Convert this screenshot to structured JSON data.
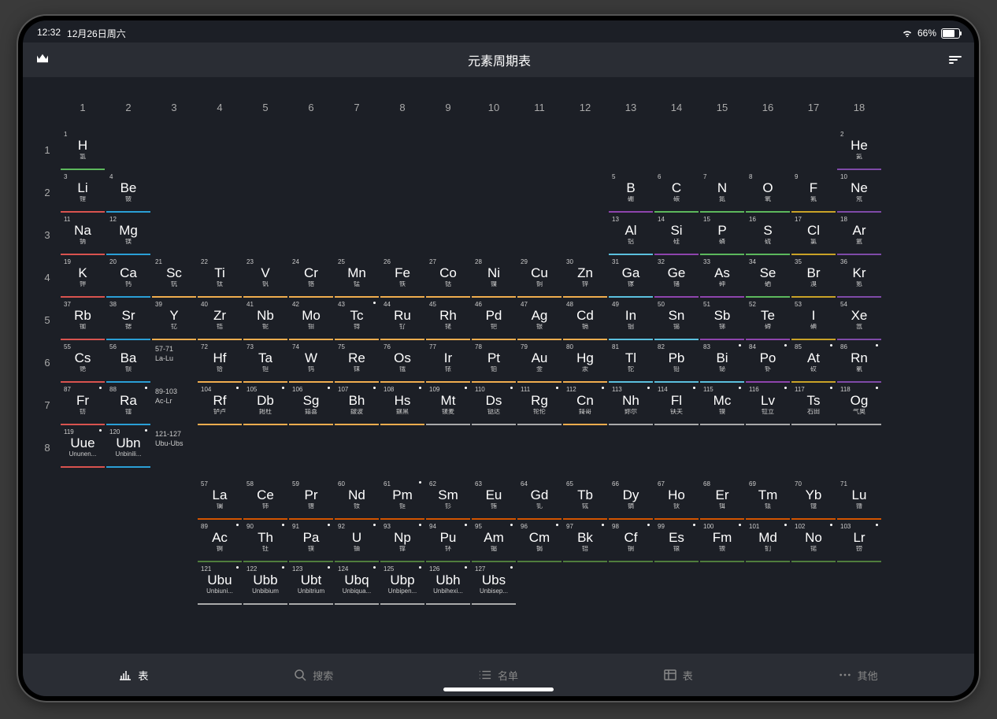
{
  "status": {
    "time": "12:32",
    "date": "12月26日周六",
    "battery": "66%"
  },
  "header": {
    "title": "元素周期表"
  },
  "tabs": [
    {
      "icon": "chart",
      "label": "表"
    },
    {
      "icon": "search",
      "label": "搜索"
    },
    {
      "icon": "list",
      "label": "名单"
    },
    {
      "icon": "grid",
      "label": "表"
    },
    {
      "icon": "more",
      "label": "其他"
    }
  ],
  "groups": [
    "1",
    "2",
    "3",
    "4",
    "5",
    "6",
    "7",
    "8",
    "9",
    "10",
    "11",
    "12",
    "13",
    "14",
    "15",
    "16",
    "17",
    "18"
  ],
  "periods": [
    "1",
    "2",
    "3",
    "4",
    "5",
    "6",
    "7",
    "8"
  ],
  "ranges": {
    "lan": {
      "top": "57-71",
      "bot": "La-Lu"
    },
    "act": {
      "top": "89-103",
      "bot": "Ac-Lr"
    },
    "ext": {
      "top": "121-127",
      "bot": "Ubu-Ubs"
    }
  },
  "elements": [
    {
      "n": 1,
      "s": "H",
      "nm": "氢",
      "r": 1,
      "c": 1,
      "cat": "nonmetal"
    },
    {
      "n": 2,
      "s": "He",
      "nm": "氦",
      "r": 1,
      "c": 18,
      "cat": "noble"
    },
    {
      "n": 3,
      "s": "Li",
      "nm": "锂",
      "r": 2,
      "c": 1,
      "cat": "alkali"
    },
    {
      "n": 4,
      "s": "Be",
      "nm": "铍",
      "r": 2,
      "c": 2,
      "cat": "alkaline"
    },
    {
      "n": 5,
      "s": "B",
      "nm": "硼",
      "r": 2,
      "c": 13,
      "cat": "metalloid"
    },
    {
      "n": 6,
      "s": "C",
      "nm": "碳",
      "r": 2,
      "c": 14,
      "cat": "nonmetal"
    },
    {
      "n": 7,
      "s": "N",
      "nm": "氮",
      "r": 2,
      "c": 15,
      "cat": "nonmetal"
    },
    {
      "n": 8,
      "s": "O",
      "nm": "氧",
      "r": 2,
      "c": 16,
      "cat": "nonmetal"
    },
    {
      "n": 9,
      "s": "F",
      "nm": "氟",
      "r": 2,
      "c": 17,
      "cat": "halogen"
    },
    {
      "n": 10,
      "s": "Ne",
      "nm": "氖",
      "r": 2,
      "c": 18,
      "cat": "noble"
    },
    {
      "n": 11,
      "s": "Na",
      "nm": "钠",
      "r": 3,
      "c": 1,
      "cat": "alkali"
    },
    {
      "n": 12,
      "s": "Mg",
      "nm": "镁",
      "r": 3,
      "c": 2,
      "cat": "alkaline"
    },
    {
      "n": 13,
      "s": "Al",
      "nm": "铝",
      "r": 3,
      "c": 13,
      "cat": "post"
    },
    {
      "n": 14,
      "s": "Si",
      "nm": "硅",
      "r": 3,
      "c": 14,
      "cat": "metalloid"
    },
    {
      "n": 15,
      "s": "P",
      "nm": "磷",
      "r": 3,
      "c": 15,
      "cat": "nonmetal"
    },
    {
      "n": 16,
      "s": "S",
      "nm": "硫",
      "r": 3,
      "c": 16,
      "cat": "nonmetal"
    },
    {
      "n": 17,
      "s": "Cl",
      "nm": "氯",
      "r": 3,
      "c": 17,
      "cat": "halogen"
    },
    {
      "n": 18,
      "s": "Ar",
      "nm": "氩",
      "r": 3,
      "c": 18,
      "cat": "noble"
    },
    {
      "n": 19,
      "s": "K",
      "nm": "钾",
      "r": 4,
      "c": 1,
      "cat": "alkali"
    },
    {
      "n": 20,
      "s": "Ca",
      "nm": "钙",
      "r": 4,
      "c": 2,
      "cat": "alkaline"
    },
    {
      "n": 21,
      "s": "Sc",
      "nm": "钪",
      "r": 4,
      "c": 3,
      "cat": "trans"
    },
    {
      "n": 22,
      "s": "Ti",
      "nm": "钛",
      "r": 4,
      "c": 4,
      "cat": "trans"
    },
    {
      "n": 23,
      "s": "V",
      "nm": "钒",
      "r": 4,
      "c": 5,
      "cat": "trans"
    },
    {
      "n": 24,
      "s": "Cr",
      "nm": "铬",
      "r": 4,
      "c": 6,
      "cat": "trans"
    },
    {
      "n": 25,
      "s": "Mn",
      "nm": "锰",
      "r": 4,
      "c": 7,
      "cat": "trans"
    },
    {
      "n": 26,
      "s": "Fe",
      "nm": "铁",
      "r": 4,
      "c": 8,
      "cat": "trans"
    },
    {
      "n": 27,
      "s": "Co",
      "nm": "钴",
      "r": 4,
      "c": 9,
      "cat": "trans"
    },
    {
      "n": 28,
      "s": "Ni",
      "nm": "镍",
      "r": 4,
      "c": 10,
      "cat": "trans"
    },
    {
      "n": 29,
      "s": "Cu",
      "nm": "铜",
      "r": 4,
      "c": 11,
      "cat": "trans"
    },
    {
      "n": 30,
      "s": "Zn",
      "nm": "锌",
      "r": 4,
      "c": 12,
      "cat": "trans"
    },
    {
      "n": 31,
      "s": "Ga",
      "nm": "镓",
      "r": 4,
      "c": 13,
      "cat": "post"
    },
    {
      "n": 32,
      "s": "Ge",
      "nm": "锗",
      "r": 4,
      "c": 14,
      "cat": "metalloid"
    },
    {
      "n": 33,
      "s": "As",
      "nm": "砷",
      "r": 4,
      "c": 15,
      "cat": "metalloid"
    },
    {
      "n": 34,
      "s": "Se",
      "nm": "硒",
      "r": 4,
      "c": 16,
      "cat": "nonmetal"
    },
    {
      "n": 35,
      "s": "Br",
      "nm": "溴",
      "r": 4,
      "c": 17,
      "cat": "halogen"
    },
    {
      "n": 36,
      "s": "Kr",
      "nm": "氪",
      "r": 4,
      "c": 18,
      "cat": "noble"
    },
    {
      "n": 37,
      "s": "Rb",
      "nm": "铷",
      "r": 5,
      "c": 1,
      "cat": "alkali"
    },
    {
      "n": 38,
      "s": "Sr",
      "nm": "锶",
      "r": 5,
      "c": 2,
      "cat": "alkaline"
    },
    {
      "n": 39,
      "s": "Y",
      "nm": "钇",
      "r": 5,
      "c": 3,
      "cat": "trans"
    },
    {
      "n": 40,
      "s": "Zr",
      "nm": "锆",
      "r": 5,
      "c": 4,
      "cat": "trans"
    },
    {
      "n": 41,
      "s": "Nb",
      "nm": "铌",
      "r": 5,
      "c": 5,
      "cat": "trans"
    },
    {
      "n": 42,
      "s": "Mo",
      "nm": "钼",
      "r": 5,
      "c": 6,
      "cat": "trans"
    },
    {
      "n": 43,
      "s": "Tc",
      "nm": "锝",
      "r": 5,
      "c": 7,
      "cat": "trans",
      "d": 1
    },
    {
      "n": 44,
      "s": "Ru",
      "nm": "钌",
      "r": 5,
      "c": 8,
      "cat": "trans"
    },
    {
      "n": 45,
      "s": "Rh",
      "nm": "铑",
      "r": 5,
      "c": 9,
      "cat": "trans"
    },
    {
      "n": 46,
      "s": "Pd",
      "nm": "钯",
      "r": 5,
      "c": 10,
      "cat": "trans"
    },
    {
      "n": 47,
      "s": "Ag",
      "nm": "银",
      "r": 5,
      "c": 11,
      "cat": "trans"
    },
    {
      "n": 48,
      "s": "Cd",
      "nm": "镉",
      "r": 5,
      "c": 12,
      "cat": "trans"
    },
    {
      "n": 49,
      "s": "In",
      "nm": "铟",
      "r": 5,
      "c": 13,
      "cat": "post"
    },
    {
      "n": 50,
      "s": "Sn",
      "nm": "锡",
      "r": 5,
      "c": 14,
      "cat": "post"
    },
    {
      "n": 51,
      "s": "Sb",
      "nm": "锑",
      "r": 5,
      "c": 15,
      "cat": "metalloid"
    },
    {
      "n": 52,
      "s": "Te",
      "nm": "碲",
      "r": 5,
      "c": 16,
      "cat": "metalloid"
    },
    {
      "n": 53,
      "s": "I",
      "nm": "碘",
      "r": 5,
      "c": 17,
      "cat": "halogen"
    },
    {
      "n": 54,
      "s": "Xe",
      "nm": "氙",
      "r": 5,
      "c": 18,
      "cat": "noble"
    },
    {
      "n": 55,
      "s": "Cs",
      "nm": "铯",
      "r": 6,
      "c": 1,
      "cat": "alkali"
    },
    {
      "n": 56,
      "s": "Ba",
      "nm": "钡",
      "r": 6,
      "c": 2,
      "cat": "alkaline"
    },
    {
      "n": 72,
      "s": "Hf",
      "nm": "铪",
      "r": 6,
      "c": 4,
      "cat": "trans"
    },
    {
      "n": 73,
      "s": "Ta",
      "nm": "钽",
      "r": 6,
      "c": 5,
      "cat": "trans"
    },
    {
      "n": 74,
      "s": "W",
      "nm": "钨",
      "r": 6,
      "c": 6,
      "cat": "trans"
    },
    {
      "n": 75,
      "s": "Re",
      "nm": "铼",
      "r": 6,
      "c": 7,
      "cat": "trans"
    },
    {
      "n": 76,
      "s": "Os",
      "nm": "锇",
      "r": 6,
      "c": 8,
      "cat": "trans"
    },
    {
      "n": 77,
      "s": "Ir",
      "nm": "铱",
      "r": 6,
      "c": 9,
      "cat": "trans"
    },
    {
      "n": 78,
      "s": "Pt",
      "nm": "铂",
      "r": 6,
      "c": 10,
      "cat": "trans"
    },
    {
      "n": 79,
      "s": "Au",
      "nm": "金",
      "r": 6,
      "c": 11,
      "cat": "trans"
    },
    {
      "n": 80,
      "s": "Hg",
      "nm": "汞",
      "r": 6,
      "c": 12,
      "cat": "trans"
    },
    {
      "n": 81,
      "s": "Tl",
      "nm": "铊",
      "r": 6,
      "c": 13,
      "cat": "post"
    },
    {
      "n": 82,
      "s": "Pb",
      "nm": "铅",
      "r": 6,
      "c": 14,
      "cat": "post"
    },
    {
      "n": 83,
      "s": "Bi",
      "nm": "铋",
      "r": 6,
      "c": 15,
      "cat": "post",
      "d": 1
    },
    {
      "n": 84,
      "s": "Po",
      "nm": "钋",
      "r": 6,
      "c": 16,
      "cat": "metalloid",
      "d": 1
    },
    {
      "n": 85,
      "s": "At",
      "nm": "砹",
      "r": 6,
      "c": 17,
      "cat": "halogen",
      "d": 1
    },
    {
      "n": 86,
      "s": "Rn",
      "nm": "氡",
      "r": 6,
      "c": 18,
      "cat": "noble",
      "d": 1
    },
    {
      "n": 87,
      "s": "Fr",
      "nm": "钫",
      "r": 7,
      "c": 1,
      "cat": "alkali",
      "d": 1
    },
    {
      "n": 88,
      "s": "Ra",
      "nm": "镭",
      "r": 7,
      "c": 2,
      "cat": "alkaline",
      "d": 1
    },
    {
      "n": 104,
      "s": "Rf",
      "nm": "𬬻卢",
      "r": 7,
      "c": 4,
      "cat": "trans",
      "d": 1
    },
    {
      "n": 105,
      "s": "Db",
      "nm": "𨧀杜",
      "r": 7,
      "c": 5,
      "cat": "trans",
      "d": 1
    },
    {
      "n": 106,
      "s": "Sg",
      "nm": "𨭎喜",
      "r": 7,
      "c": 6,
      "cat": "trans",
      "d": 1
    },
    {
      "n": 107,
      "s": "Bh",
      "nm": "𨨏波",
      "r": 7,
      "c": 7,
      "cat": "trans",
      "d": 1
    },
    {
      "n": 108,
      "s": "Hs",
      "nm": "𨭆黑",
      "r": 7,
      "c": 8,
      "cat": "trans",
      "d": 1
    },
    {
      "n": 109,
      "s": "Mt",
      "nm": "鿏麦",
      "r": 7,
      "c": 9,
      "cat": "unknown",
      "d": 1
    },
    {
      "n": 110,
      "s": "Ds",
      "nm": "𫟼达",
      "r": 7,
      "c": 10,
      "cat": "unknown",
      "d": 1
    },
    {
      "n": 111,
      "s": "Rg",
      "nm": "𬬭伦",
      "r": 7,
      "c": 11,
      "cat": "unknown",
      "d": 1
    },
    {
      "n": 112,
      "s": "Cn",
      "nm": "鎶哥",
      "r": 7,
      "c": 12,
      "cat": "trans",
      "d": 1
    },
    {
      "n": 113,
      "s": "Nh",
      "nm": "鉨尔",
      "r": 7,
      "c": 13,
      "cat": "unknown",
      "d": 1
    },
    {
      "n": 114,
      "s": "Fl",
      "nm": "𫓧夫",
      "r": 7,
      "c": 14,
      "cat": "unknown",
      "d": 1
    },
    {
      "n": 115,
      "s": "Mc",
      "nm": "镆",
      "r": 7,
      "c": 15,
      "cat": "unknown",
      "d": 1
    },
    {
      "n": 116,
      "s": "Lv",
      "nm": "𫟷立",
      "r": 7,
      "c": 16,
      "cat": "unknown",
      "d": 1
    },
    {
      "n": 117,
      "s": "Ts",
      "nm": "石田",
      "r": 7,
      "c": 17,
      "cat": "unknown",
      "d": 1
    },
    {
      "n": 118,
      "s": "Og",
      "nm": "气奥",
      "r": 7,
      "c": 18,
      "cat": "unknown",
      "d": 1
    },
    {
      "n": 119,
      "s": "Uue",
      "nm": "Ununen...",
      "r": 8,
      "c": 1,
      "cat": "alkali",
      "d": 1
    },
    {
      "n": 120,
      "s": "Ubn",
      "nm": "Unbinili...",
      "r": 8,
      "c": 2,
      "cat": "alkaline",
      "d": 1
    }
  ],
  "lanthanides": [
    {
      "n": 57,
      "s": "La",
      "nm": "镧",
      "cat": "lan"
    },
    {
      "n": 58,
      "s": "Ce",
      "nm": "铈",
      "cat": "lan"
    },
    {
      "n": 59,
      "s": "Pr",
      "nm": "镨",
      "cat": "lan"
    },
    {
      "n": 60,
      "s": "Nd",
      "nm": "钕",
      "cat": "lan"
    },
    {
      "n": 61,
      "s": "Pm",
      "nm": "钷",
      "cat": "lan",
      "d": 1
    },
    {
      "n": 62,
      "s": "Sm",
      "nm": "钐",
      "cat": "lan"
    },
    {
      "n": 63,
      "s": "Eu",
      "nm": "铕",
      "cat": "lan"
    },
    {
      "n": 64,
      "s": "Gd",
      "nm": "钆",
      "cat": "lan"
    },
    {
      "n": 65,
      "s": "Tb",
      "nm": "铽",
      "cat": "lan"
    },
    {
      "n": 66,
      "s": "Dy",
      "nm": "镝",
      "cat": "lan"
    },
    {
      "n": 67,
      "s": "Ho",
      "nm": "钬",
      "cat": "lan"
    },
    {
      "n": 68,
      "s": "Er",
      "nm": "铒",
      "cat": "lan"
    },
    {
      "n": 69,
      "s": "Tm",
      "nm": "铥",
      "cat": "lan"
    },
    {
      "n": 70,
      "s": "Yb",
      "nm": "镱",
      "cat": "lan"
    },
    {
      "n": 71,
      "s": "Lu",
      "nm": "镥",
      "cat": "lan"
    }
  ],
  "actinides": [
    {
      "n": 89,
      "s": "Ac",
      "nm": "锕",
      "cat": "act",
      "d": 1
    },
    {
      "n": 90,
      "s": "Th",
      "nm": "钍",
      "cat": "act",
      "d": 1
    },
    {
      "n": 91,
      "s": "Pa",
      "nm": "镤",
      "cat": "act",
      "d": 1
    },
    {
      "n": 92,
      "s": "U",
      "nm": "铀",
      "cat": "act",
      "d": 1
    },
    {
      "n": 93,
      "s": "Np",
      "nm": "镎",
      "cat": "act",
      "d": 1
    },
    {
      "n": 94,
      "s": "Pu",
      "nm": "钚",
      "cat": "act",
      "d": 1
    },
    {
      "n": 95,
      "s": "Am",
      "nm": "镅",
      "cat": "act",
      "d": 1
    },
    {
      "n": 96,
      "s": "Cm",
      "nm": "锔",
      "cat": "act",
      "d": 1
    },
    {
      "n": 97,
      "s": "Bk",
      "nm": "锫",
      "cat": "act",
      "d": 1
    },
    {
      "n": 98,
      "s": "Cf",
      "nm": "锎",
      "cat": "act",
      "d": 1
    },
    {
      "n": 99,
      "s": "Es",
      "nm": "锿",
      "cat": "act",
      "d": 1
    },
    {
      "n": 100,
      "s": "Fm",
      "nm": "镄",
      "cat": "act",
      "d": 1
    },
    {
      "n": 101,
      "s": "Md",
      "nm": "钔",
      "cat": "act",
      "d": 1
    },
    {
      "n": 102,
      "s": "No",
      "nm": "锘",
      "cat": "act",
      "d": 1
    },
    {
      "n": 103,
      "s": "Lr",
      "nm": "铹",
      "cat": "act",
      "d": 1
    }
  ],
  "extended": [
    {
      "n": 121,
      "s": "Ubu",
      "nm": "Unbiuni...",
      "cat": "unknown",
      "d": 1
    },
    {
      "n": 122,
      "s": "Ubb",
      "nm": "Unbibium",
      "cat": "unknown",
      "d": 1
    },
    {
      "n": 123,
      "s": "Ubt",
      "nm": "Unbitrium",
      "cat": "unknown",
      "d": 1
    },
    {
      "n": 124,
      "s": "Ubq",
      "nm": "Unbiqua...",
      "cat": "unknown",
      "d": 1
    },
    {
      "n": 125,
      "s": "Ubp",
      "nm": "Unbipen...",
      "cat": "unknown",
      "d": 1
    },
    {
      "n": 126,
      "s": "Ubh",
      "nm": "Unbihexi...",
      "cat": "unknown",
      "d": 1
    },
    {
      "n": 127,
      "s": "Ubs",
      "nm": "Unbisep...",
      "cat": "unknown",
      "d": 1
    }
  ]
}
